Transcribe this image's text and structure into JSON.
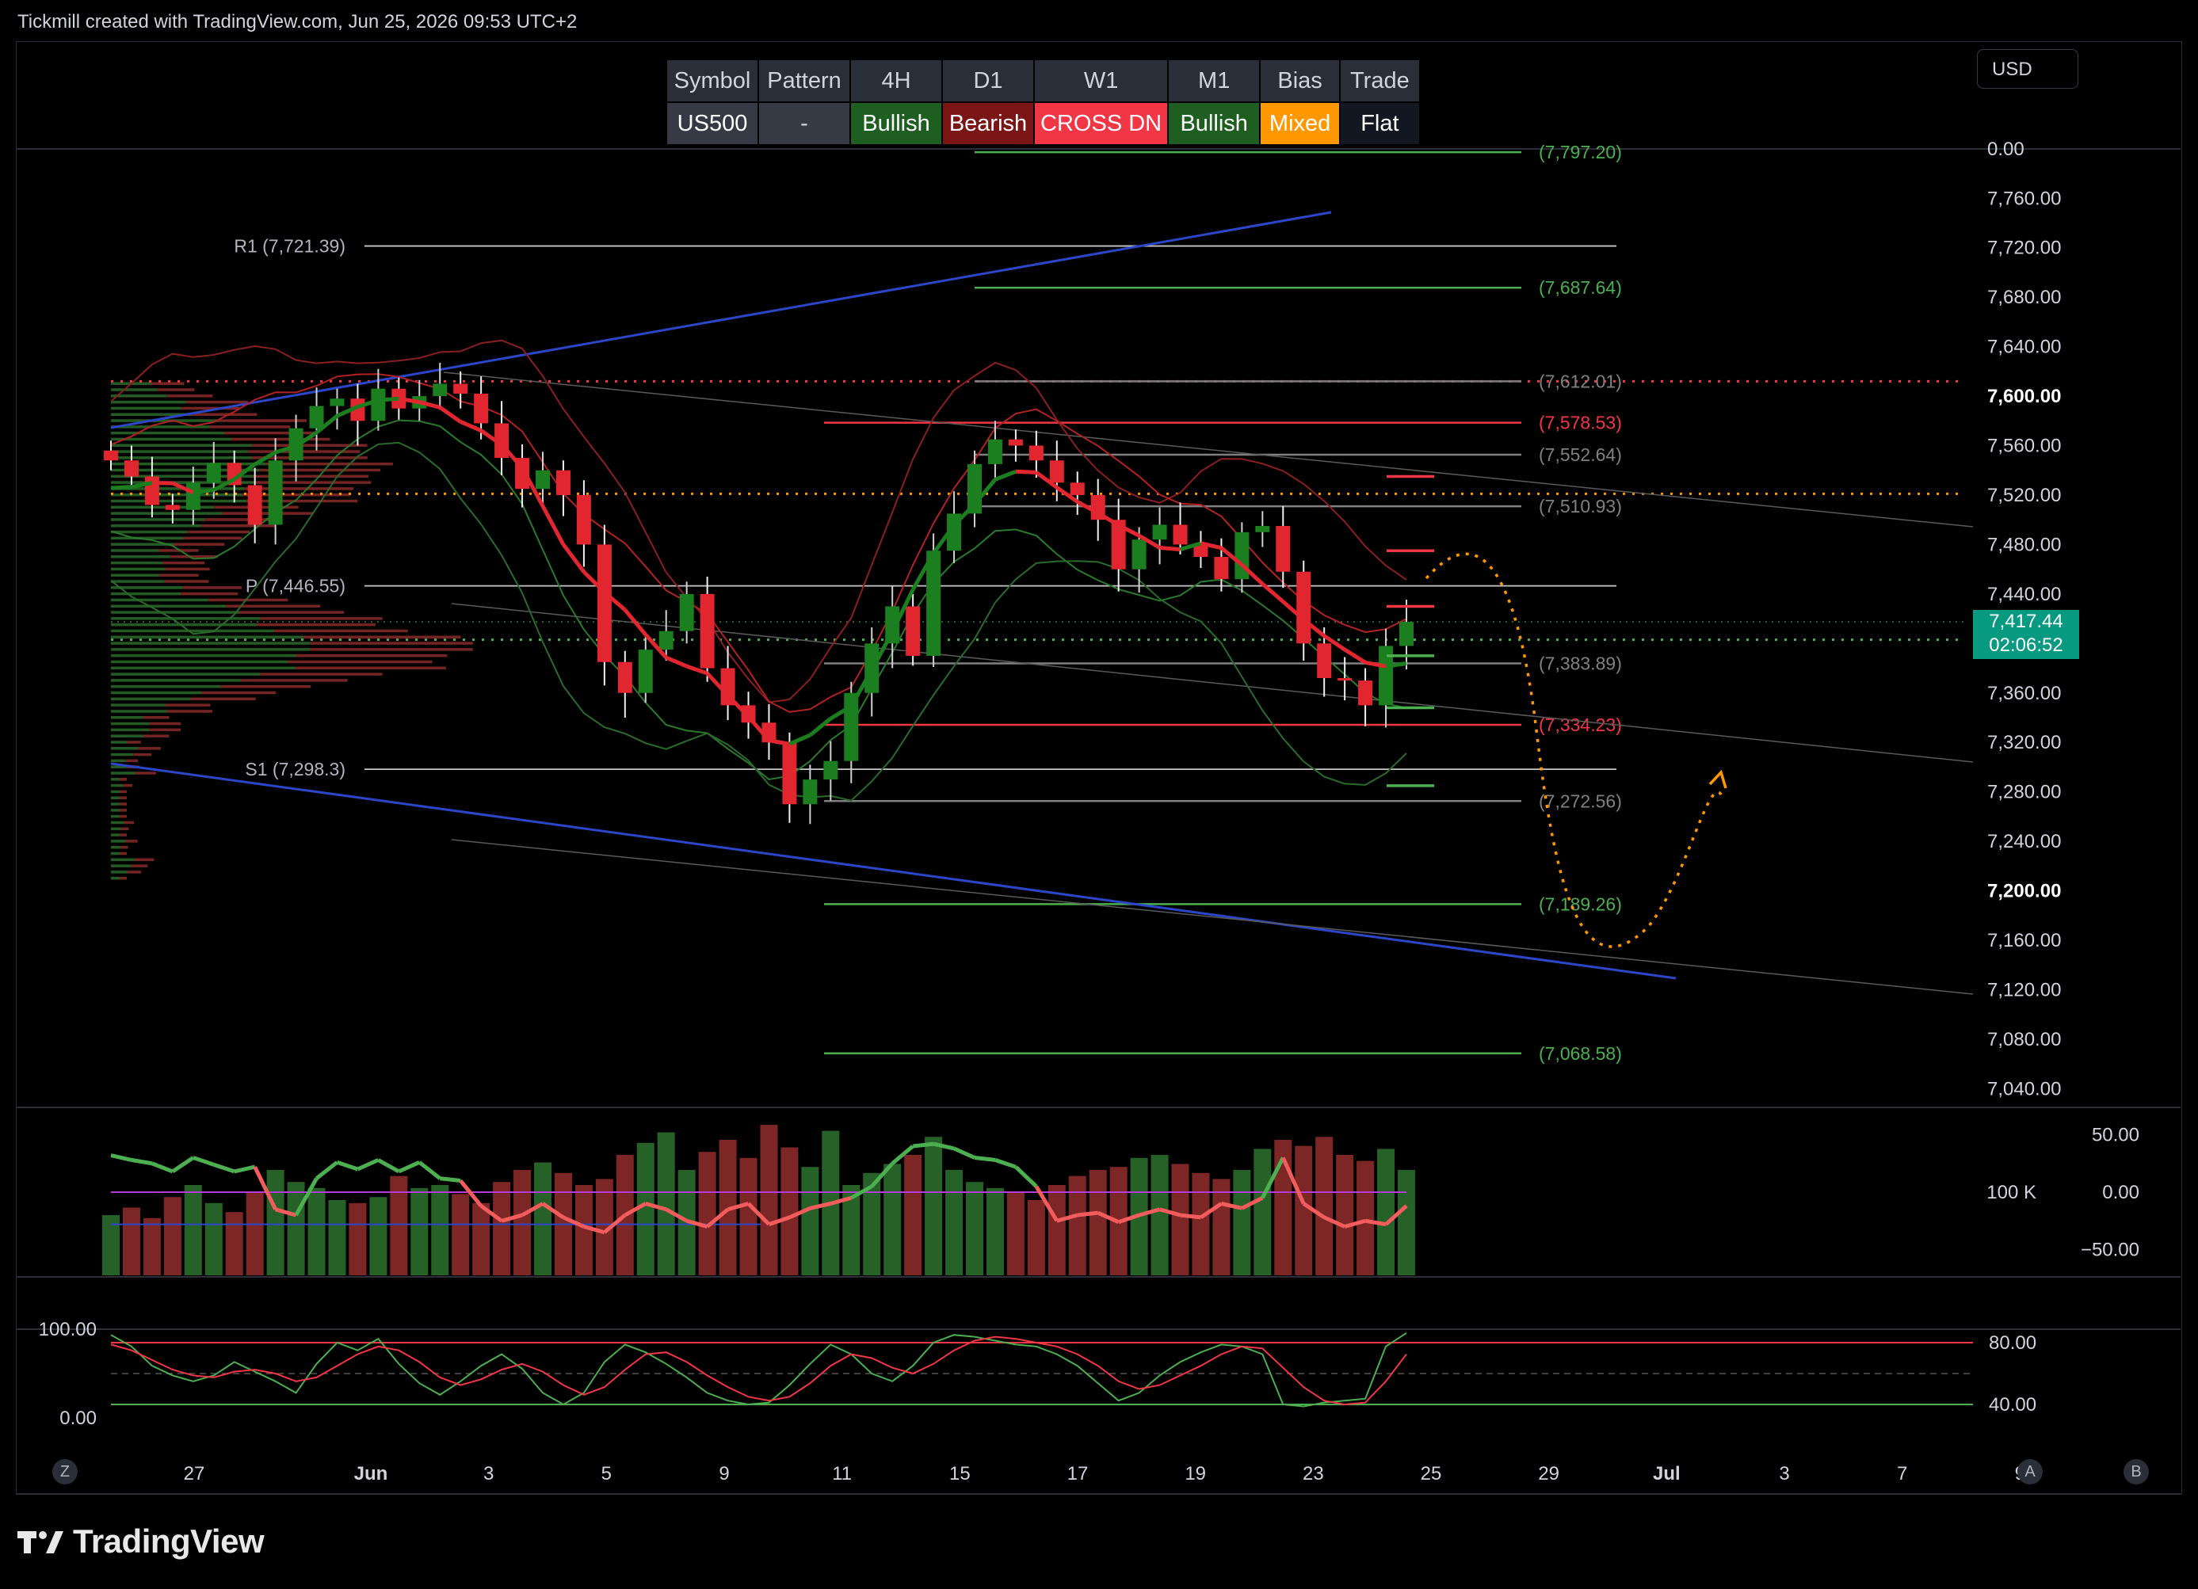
{
  "header": {
    "attribution": "Tickmill created with TradingView.com, Jun 25, 2026 09:53 UTC+2"
  },
  "currency_button": "USD",
  "logo_text": "TradingView",
  "table": {
    "headers": [
      "Symbol",
      "Pattern",
      "4H",
      "D1",
      "W1",
      "M1",
      "Bias",
      "Trade"
    ],
    "values": [
      "US500",
      "-",
      "Bullish",
      "Bearish",
      "CROSS DN",
      "Bullish",
      "Mixed",
      "Flat"
    ],
    "value_colors": [
      "#363a45",
      "#363a45",
      "#1e5e20",
      "#7a1616",
      "#f23645",
      "#1e5e20",
      "#ff9800",
      "#131722"
    ]
  },
  "price_badge": {
    "price": "7,417.44",
    "countdown": "02:06:52"
  },
  "scale_buttons": {
    "left": "Z",
    "a": "A",
    "b": "B"
  },
  "chart_data": [
    {
      "type": "line",
      "title": "",
      "y_ticks": [
        "0.00",
        "7,760.00",
        "7,720.00",
        "7,680.00",
        "7,640.00",
        "7,600.00",
        "7,560.00",
        "7,520.00",
        "7,480.00",
        "7,440.00",
        "7,360.00",
        "7,320.00",
        "7,280.00",
        "7,240.00",
        "7,200.00",
        "7,160.00",
        "7,120.00",
        "7,080.00",
        "7,040.00"
      ],
      "y_tick_values": [
        7800,
        7760,
        7720,
        7680,
        7640,
        7600,
        7560,
        7520,
        7480,
        7440,
        7360,
        7320,
        7280,
        7240,
        7200,
        7160,
        7120,
        7080,
        7040
      ],
      "bold_ticks": [
        "7,600.00",
        "7,200.00"
      ],
      "x_ticks": [
        "27",
        "Jun",
        "3",
        "5",
        "9",
        "11",
        "15",
        "17",
        "19",
        "23",
        "25",
        "29",
        "Jul",
        "3",
        "7",
        "9"
      ],
      "x_tick_positions": [
        0.0,
        1.5,
        2.5,
        3.5,
        4.5,
        5.5,
        6.5,
        7.5,
        8.5,
        9.5,
        10.5,
        11.5,
        12.5,
        13.5,
        14.5,
        15.5
      ],
      "ylim": [
        7030,
        7805
      ],
      "pivot_levels": [
        {
          "label": "R1 (7,721.39)",
          "value": 7721.39
        },
        {
          "label": "P (7,446.55)",
          "value": 7446.55
        },
        {
          "label": "S1 (7,298.3)",
          "value": 7298.3
        }
      ],
      "fib_levels": [
        {
          "label": "(7,797.20)",
          "value": 7797.2,
          "color": "#4caf50"
        },
        {
          "label": "(7,687.64)",
          "value": 7687.64,
          "color": "#4caf50"
        },
        {
          "label": "(7,612.01)",
          "value": 7612.01,
          "color": "#808080"
        },
        {
          "label": "(7,578.53)",
          "value": 7578.53,
          "color": "#f23645"
        },
        {
          "label": "(7,552.64)",
          "value": 7552.64,
          "color": "#808080"
        },
        {
          "label": "(7,510.93)",
          "value": 7510.93,
          "color": "#808080"
        },
        {
          "label": "(7,383.89)",
          "value": 7383.89,
          "color": "#808080"
        },
        {
          "label": "(7,334.23)",
          "value": 7334.23,
          "color": "#f23645"
        },
        {
          "label": "(7,272.56)",
          "value": 7272.56,
          "color": "#808080"
        },
        {
          "label": "(7,189.26)",
          "value": 7189.26,
          "color": "#4caf50"
        },
        {
          "label": "(7,068.58)",
          "value": 7068.58,
          "color": "#4caf50"
        }
      ],
      "close_series": [
        7548,
        7535,
        7512,
        7508,
        7530,
        7546,
        7528,
        7496,
        7548,
        7574,
        7592,
        7598,
        7580,
        7606,
        7590,
        7600,
        7610,
        7602,
        7578,
        7550,
        7525,
        7540,
        7520,
        7480,
        7385,
        7360,
        7395,
        7410,
        7440,
        7380,
        7350,
        7336,
        7320,
        7270,
        7290,
        7305,
        7360,
        7400,
        7430,
        7390,
        7475,
        7505,
        7545,
        7565,
        7560,
        7548,
        7530,
        7520,
        7500,
        7460,
        7484,
        7496,
        7480,
        7470,
        7452,
        7490,
        7495,
        7458,
        7400,
        7372,
        7370,
        7350,
        7398,
        7417.44
      ],
      "colors": {
        "up": "#089981",
        "down": "#f23645",
        "candle_up": "#1b7e1f",
        "candle_down": "#e2262f"
      }
    },
    {
      "type": "bar",
      "title": "",
      "y_ticks": [
        "50.00",
        "0.00",
        "−50.00"
      ],
      "volume_label": "100 K",
      "volume": [
        40,
        45,
        38,
        52,
        60,
        48,
        42,
        55,
        70,
        62,
        58,
        50,
        48,
        52,
        66,
        58,
        60,
        54,
        48,
        62,
        70,
        75,
        68,
        60,
        64,
        80,
        88,
        95,
        70,
        82,
        90,
        78,
        100,
        85,
        72,
        96,
        60,
        68,
        74,
        80,
        92,
        70,
        62,
        58,
        55,
        50,
        60,
        66,
        70,
        72,
        78,
        80,
        74,
        68,
        64,
        70,
        84,
        90,
        86,
        92,
        80,
        76,
        84,
        70
      ],
      "oscillator": [
        32,
        28,
        25,
        18,
        30,
        24,
        18,
        22,
        -15,
        -20,
        12,
        26,
        20,
        28,
        18,
        26,
        12,
        10,
        -12,
        -25,
        -20,
        -10,
        -22,
        -30,
        -35,
        -20,
        -10,
        -15,
        -25,
        -30,
        -15,
        -10,
        -28,
        -22,
        -14,
        -10,
        -5,
        5,
        25,
        40,
        42,
        38,
        30,
        28,
        22,
        5,
        -25,
        -20,
        -18,
        -26,
        -20,
        -15,
        -20,
        -22,
        -10,
        -14,
        -5,
        30,
        -10,
        -22,
        -30,
        -25,
        -28,
        -12
      ]
    },
    {
      "type": "line",
      "title": "",
      "y_ticks_left": [
        "100.00",
        "0.00"
      ],
      "y_ticks_right": [
        "80.00",
        "40.00"
      ],
      "stoch_k": [
        90,
        78,
        58,
        48,
        42,
        48,
        62,
        52,
        42,
        30,
        60,
        82,
        74,
        86,
        60,
        40,
        28,
        42,
        58,
        70,
        55,
        30,
        18,
        30,
        62,
        80,
        72,
        60,
        46,
        30,
        22,
        18,
        20,
        38,
        60,
        80,
        70,
        50,
        42,
        58,
        82,
        90,
        88,
        84,
        80,
        78,
        70,
        58,
        40,
        22,
        30,
        48,
        62,
        72,
        80,
        78,
        70,
        18,
        16,
        20,
        22,
        24,
        78,
        92
      ],
      "stoch_d": [
        80,
        74,
        64,
        54,
        48,
        46,
        52,
        54,
        50,
        42,
        46,
        58,
        70,
        78,
        74,
        62,
        46,
        38,
        44,
        54,
        60,
        52,
        38,
        28,
        36,
        54,
        70,
        72,
        62,
        48,
        36,
        26,
        22,
        26,
        40,
        58,
        70,
        66,
        56,
        50,
        60,
        74,
        84,
        88,
        86,
        82,
        78,
        70,
        58,
        42,
        34,
        38,
        48,
        58,
        70,
        78,
        76,
        56,
        36,
        22,
        18,
        20,
        42,
        70
      ]
    }
  ]
}
